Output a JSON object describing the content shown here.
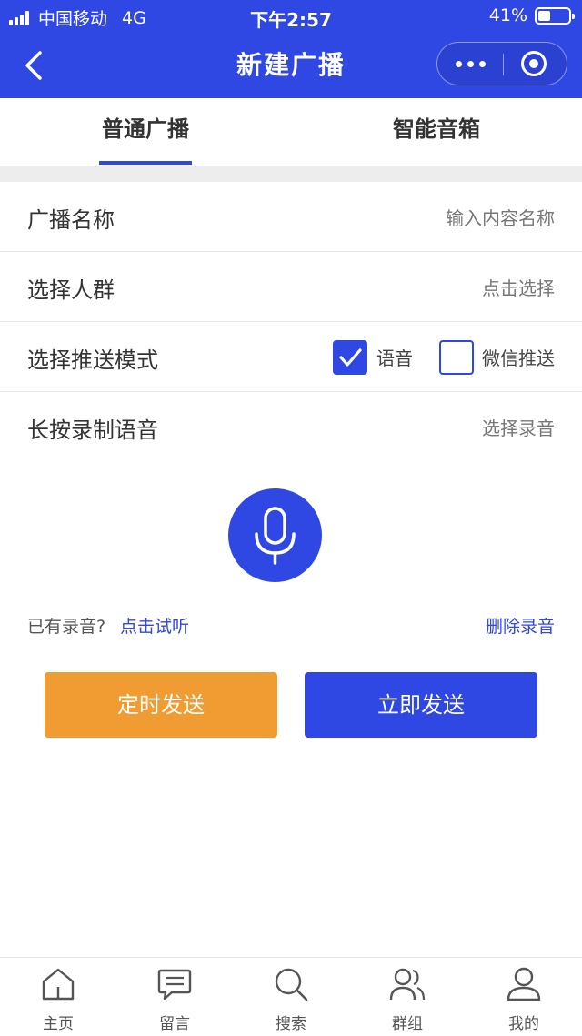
{
  "status_bar": {
    "carrier": "中国移动",
    "network": "4G",
    "time": "下午2:57",
    "battery_text": "41%",
    "battery_level": 0.41
  },
  "nav": {
    "title": "新建广播"
  },
  "tabs": [
    {
      "label": "普通广播",
      "active": true
    },
    {
      "label": "智能音箱",
      "active": false
    }
  ],
  "form": {
    "name_label": "广播名称",
    "name_placeholder": "输入内容名称",
    "audience_label": "选择人群",
    "audience_action": "点击选择",
    "mode_label": "选择推送模式",
    "mode_options": [
      {
        "label": "语音",
        "checked": true
      },
      {
        "label": "微信推送",
        "checked": false
      }
    ],
    "record_label": "长按录制语音",
    "record_action": "选择录音"
  },
  "recording": {
    "hint": "已有录音?",
    "play_link": "点击试听",
    "delete_link": "删除录音"
  },
  "buttons": {
    "scheduled": "定时发送",
    "immediate": "立即发送"
  },
  "tabbar": [
    {
      "label": "主页",
      "icon": "home-icon"
    },
    {
      "label": "留言",
      "icon": "message-icon"
    },
    {
      "label": "搜索",
      "icon": "search-icon"
    },
    {
      "label": "群组",
      "icon": "group-icon"
    },
    {
      "label": "我的",
      "icon": "user-icon"
    }
  ],
  "colors": {
    "primary": "#2f47e3",
    "accent_orange": "#f09c32"
  }
}
